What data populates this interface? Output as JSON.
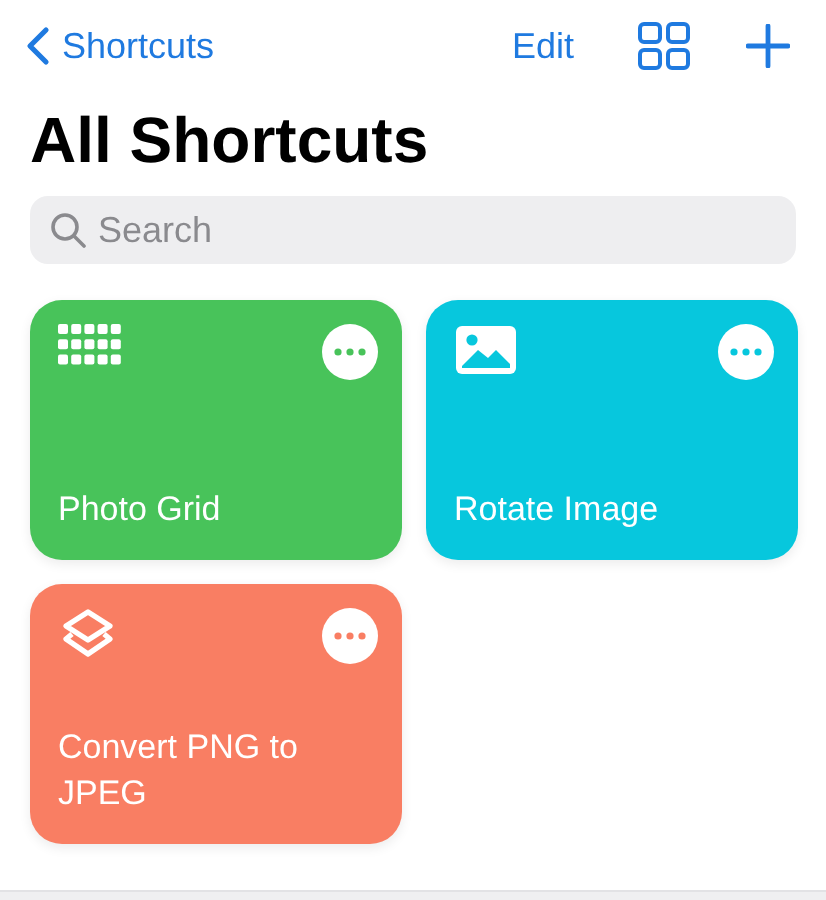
{
  "nav": {
    "back_label": "Shortcuts",
    "edit_label": "Edit"
  },
  "title": "All Shortcuts",
  "search": {
    "placeholder": "Search"
  },
  "shortcuts": [
    {
      "name": "Photo Grid",
      "color": "#48c35a",
      "kind": "grid"
    },
    {
      "name": "Rotate Image",
      "color": "#07c7dd",
      "kind": "image"
    },
    {
      "name": "Convert PNG to JPEG",
      "color": "#f97e63",
      "kind": "layers"
    }
  ]
}
